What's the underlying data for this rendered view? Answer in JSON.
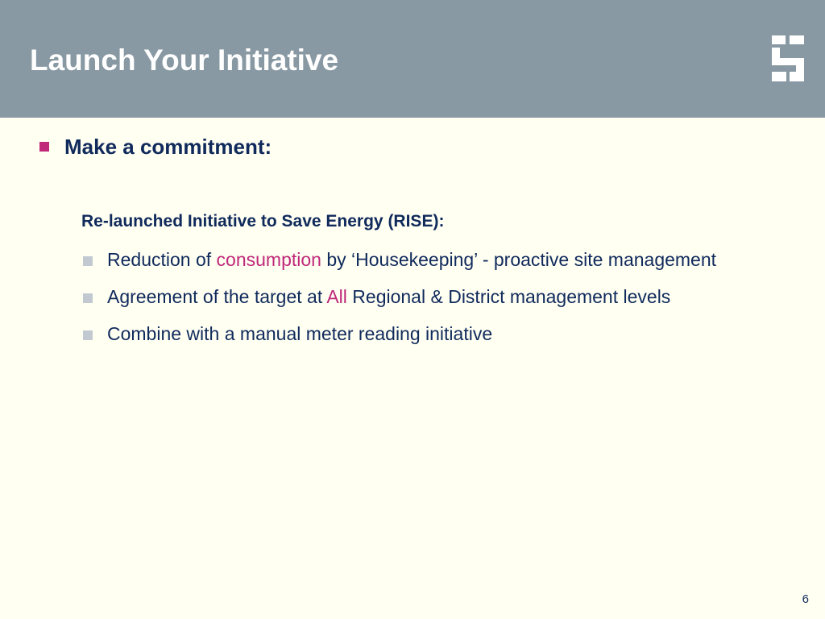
{
  "slide": {
    "title": "Launch Your Initiative",
    "page_number": "6"
  },
  "logo": {
    "icon": "company-logo-icon"
  },
  "content": {
    "level1": "Make a commitment:",
    "subheading": "Re-launched Initiative to Save Energy (RISE):",
    "items": [
      {
        "before": "Reduction of ",
        "highlight": "consumption",
        "after": " by ‘Housekeeping’ - proactive site management"
      },
      {
        "before": "Agreement of the target at ",
        "highlight": "All",
        "after": " Regional & District management levels"
      },
      {
        "before": "Combine with a manual meter reading initiative",
        "highlight": "",
        "after": ""
      }
    ]
  },
  "colors": {
    "header_bg": "#8899a3",
    "slide_bg": "#fffff2",
    "text_navy": "#102a5c",
    "accent_magenta": "#c0287a",
    "bullet_grey": "#c2c9d1"
  }
}
